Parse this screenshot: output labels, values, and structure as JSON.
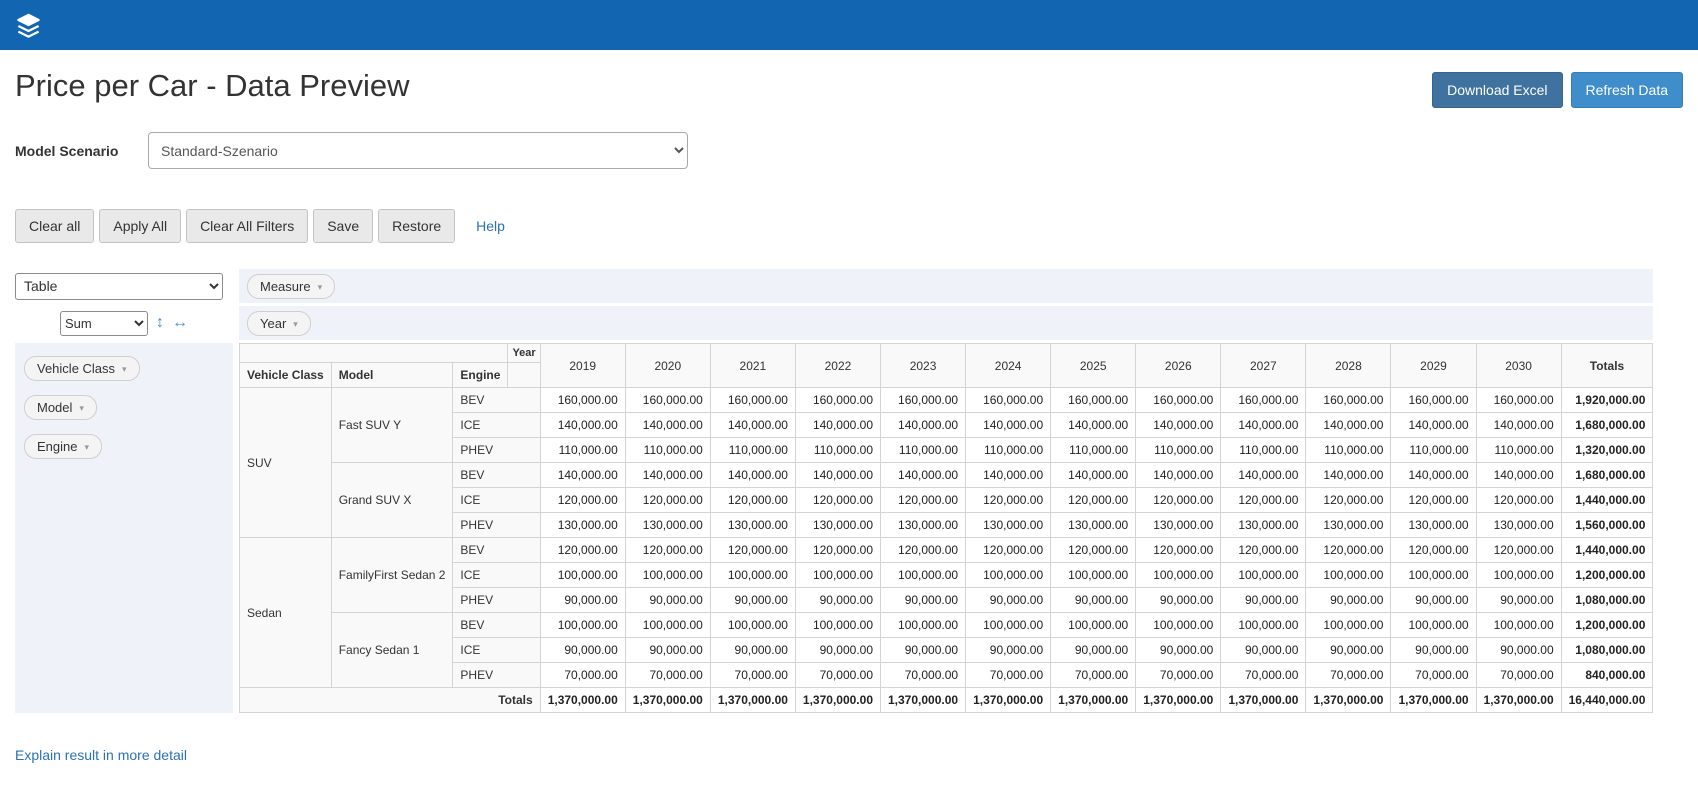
{
  "page": {
    "title": "Price per Car - Data Preview",
    "download_button": "Download Excel",
    "refresh_button": "Refresh Data",
    "explain_link": "Explain result in more detail"
  },
  "scenario": {
    "label": "Model Scenario",
    "selected": "Standard-Szenario"
  },
  "toolbar": {
    "buttons": [
      {
        "name": "clear-all-button",
        "label": "Clear all"
      },
      {
        "name": "apply-all-button",
        "label": "Apply All"
      },
      {
        "name": "clear-all-filters-button",
        "label": "Clear All Filters"
      },
      {
        "name": "save-button",
        "label": "Save"
      },
      {
        "name": "restore-button",
        "label": "Restore"
      }
    ],
    "help_label": "Help"
  },
  "pivot": {
    "renderer_selected": "Table",
    "aggregator_selected": "Sum",
    "row_order_icon": "↕",
    "col_order_icon": "↔",
    "unused_fields": [
      {
        "name": "field-measure",
        "label": "Measure"
      }
    ],
    "col_fields": [
      {
        "name": "field-year",
        "label": "Year"
      }
    ],
    "row_fields": [
      {
        "name": "field-vehicle-class",
        "label": "Vehicle Class"
      },
      {
        "name": "field-model",
        "label": "Model"
      },
      {
        "name": "field-engine",
        "label": "Engine"
      }
    ]
  },
  "chart_data": {
    "type": "table",
    "col_attr": "Year",
    "years": [
      "2019",
      "2020",
      "2021",
      "2022",
      "2023",
      "2024",
      "2025",
      "2026",
      "2027",
      "2028",
      "2029",
      "2030"
    ],
    "row_attrs": [
      "Vehicle Class",
      "Model",
      "Engine"
    ],
    "totals_label": "Totals",
    "rows": [
      {
        "vehicle_class": "SUV",
        "model": "Fast SUV Y",
        "engine": "BEV",
        "per_year": "160,000.00",
        "total": "1,920,000.00"
      },
      {
        "vehicle_class": "SUV",
        "model": "Fast SUV Y",
        "engine": "ICE",
        "per_year": "140,000.00",
        "total": "1,680,000.00"
      },
      {
        "vehicle_class": "SUV",
        "model": "Fast SUV Y",
        "engine": "PHEV",
        "per_year": "110,000.00",
        "total": "1,320,000.00"
      },
      {
        "vehicle_class": "SUV",
        "model": "Grand SUV X",
        "engine": "BEV",
        "per_year": "140,000.00",
        "total": "1,680,000.00"
      },
      {
        "vehicle_class": "SUV",
        "model": "Grand SUV X",
        "engine": "ICE",
        "per_year": "120,000.00",
        "total": "1,440,000.00"
      },
      {
        "vehicle_class": "SUV",
        "model": "Grand SUV X",
        "engine": "PHEV",
        "per_year": "130,000.00",
        "total": "1,560,000.00"
      },
      {
        "vehicle_class": "Sedan",
        "model": "FamilyFirst Sedan 2",
        "engine": "BEV",
        "per_year": "120,000.00",
        "total": "1,440,000.00"
      },
      {
        "vehicle_class": "Sedan",
        "model": "FamilyFirst Sedan 2",
        "engine": "ICE",
        "per_year": "100,000.00",
        "total": "1,200,000.00"
      },
      {
        "vehicle_class": "Sedan",
        "model": "FamilyFirst Sedan 2",
        "engine": "PHEV",
        "per_year": "90,000.00",
        "total": "1,080,000.00"
      },
      {
        "vehicle_class": "Sedan",
        "model": "Fancy Sedan 1",
        "engine": "BEV",
        "per_year": "100,000.00",
        "total": "1,200,000.00"
      },
      {
        "vehicle_class": "Sedan",
        "model": "Fancy Sedan 1",
        "engine": "ICE",
        "per_year": "90,000.00",
        "total": "1,080,000.00"
      },
      {
        "vehicle_class": "Sedan",
        "model": "Fancy Sedan 1",
        "engine": "PHEV",
        "per_year": "70,000.00",
        "total": "840,000.00"
      }
    ],
    "grand_total_per_year": "1,370,000.00",
    "grand_total": "16,440,000.00"
  },
  "colors": {
    "topbar": "#1266b1",
    "download_button": "#40729f",
    "refresh_button": "#3f8ecb",
    "link": "#2a72b5"
  }
}
